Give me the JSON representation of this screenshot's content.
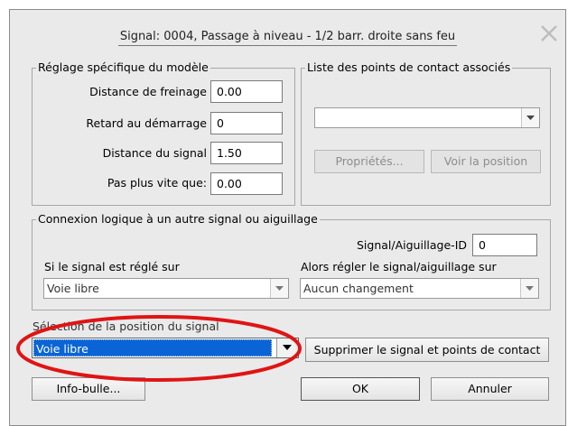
{
  "dialog": {
    "title": "Signal: 0004, Passage à niveau - 1/2 barr. droite sans feu",
    "close_icon": "close-icon"
  },
  "model_settings": {
    "legend": "Réglage spécifique du modèle",
    "braking_distance_label": "Distance de freinage",
    "braking_distance_value": "0.00",
    "start_delay_label": "Retard au démarrage",
    "start_delay_value": "0",
    "signal_distance_label": "Distance du signal",
    "signal_distance_value": "1.50",
    "max_speed_label": "Pas plus vite que:",
    "max_speed_value": "0.00"
  },
  "contacts": {
    "legend": "Liste des points de contact associés",
    "selected": "",
    "properties_button": "Propriétés...",
    "show_position_button": "Voir la position"
  },
  "logic": {
    "legend": "Connexion logique à un autre signal ou aiguillage",
    "signal_id_label": "Signal/Aiguillage-ID",
    "signal_id_value": "0",
    "if_signal_label": "Si le signal est réglé sur",
    "if_signal_value": "Voie libre",
    "then_label": "Alors régler le signal/aiguillage sur",
    "then_value": "Aucun changement"
  },
  "position": {
    "label": "Sélection de la position du signal",
    "value": "Voie libre"
  },
  "buttons": {
    "delete": "Supprimer le signal et points de contact",
    "tooltip": "Info-bulle...",
    "ok": "OK",
    "cancel": "Annuler"
  },
  "annotation": {
    "color": "#e01414"
  }
}
